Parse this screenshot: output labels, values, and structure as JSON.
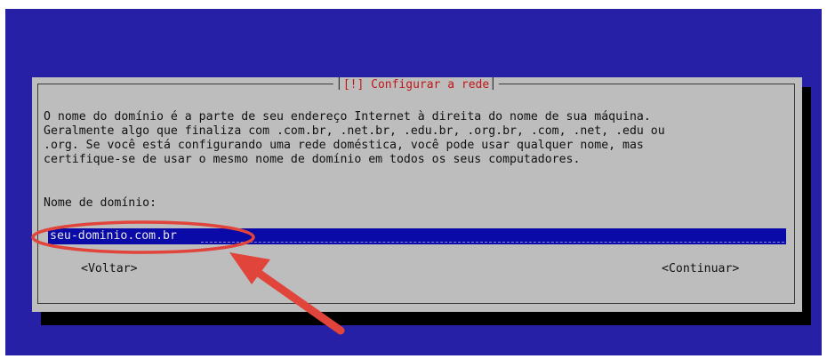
{
  "dialog": {
    "title": "[!] Configurar a rede",
    "description_lines": [
      "O nome do domínio é a parte de seu endereço Internet à direita do nome de sua máquina.",
      "Geralmente algo que finaliza com .com.br, .net.br, .edu.br, .org.br, .com, .net, .edu ou",
      ".org. Se você está configurando uma rede doméstica, você pode usar qualquer nome, mas",
      "certifique-se de usar o mesmo nome de domínio em todos os seus computadores."
    ],
    "field_label": "Nome de domínio:",
    "domain_input": {
      "value": "seu-dominio.com.br"
    },
    "buttons": {
      "back": "<Voltar>",
      "continue": "<Continuar>"
    }
  },
  "colors": {
    "screen_background": "#2620a6",
    "dialog_background": "#bdbdbd",
    "input_background": "#0a0aa8",
    "title_text": "#c01818",
    "annotation": "#e0443a"
  },
  "annotation": {
    "highlight": "red-ellipse",
    "pointer": "red-arrow-icon"
  }
}
